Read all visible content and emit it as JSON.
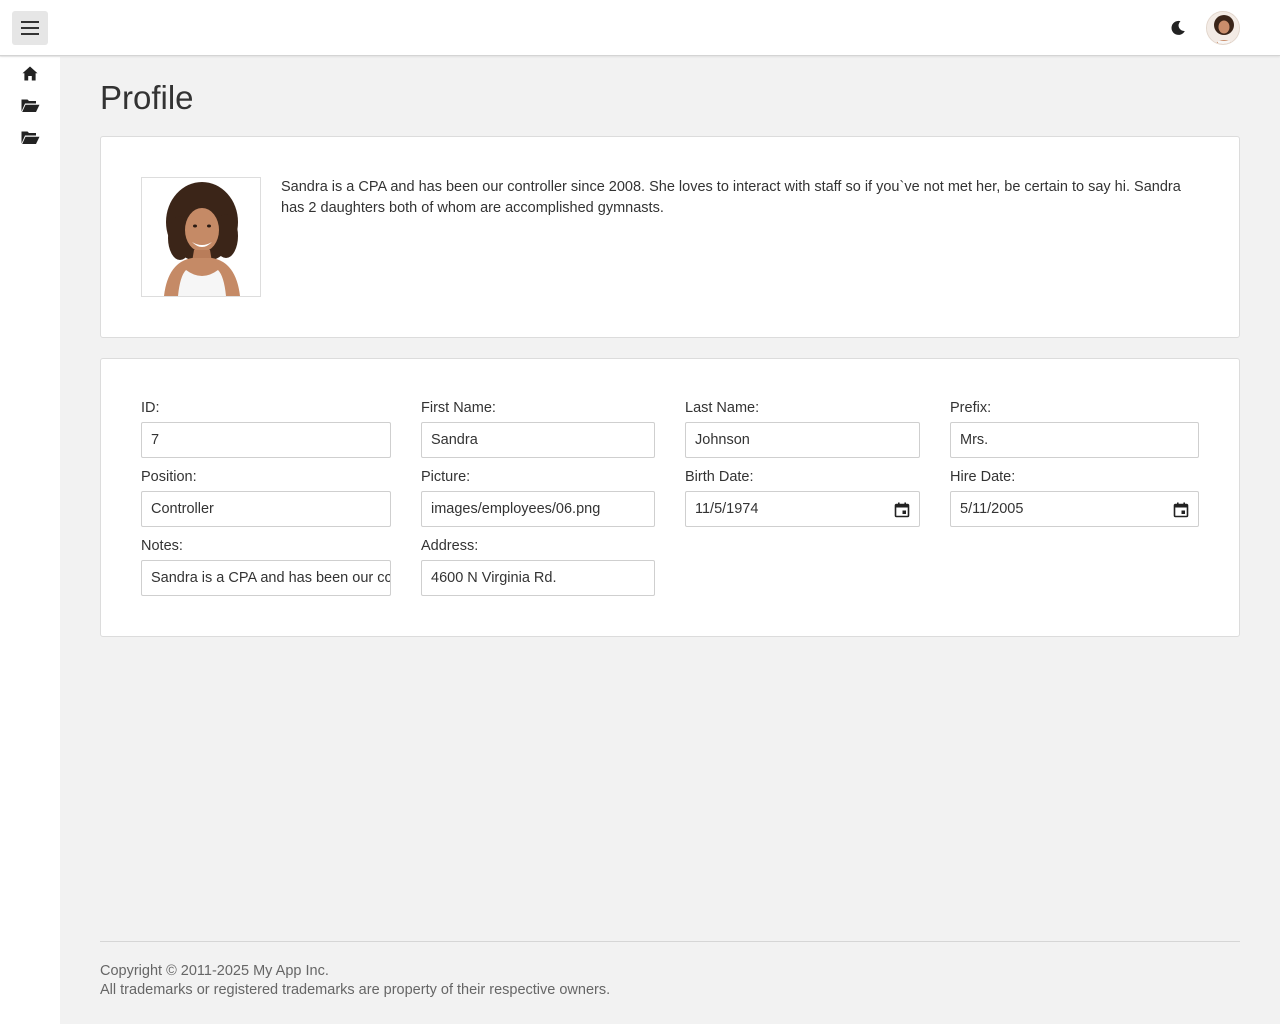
{
  "header": {
    "menu_icon": "hamburger-icon",
    "theme_icon": "moon-icon",
    "avatar_icon": "user-avatar"
  },
  "sidebar": {
    "items": [
      {
        "icon": "home-icon"
      },
      {
        "icon": "folder-open-icon"
      },
      {
        "icon": "folder-open-icon"
      }
    ]
  },
  "page": {
    "title": "Profile"
  },
  "profile": {
    "notes_text": "Sandra is a CPA and has been our controller since 2008. She loves to interact with staff so if you`ve not met her, be certain to say hi. Sandra has 2 daughters both of whom are accomplished gymnasts."
  },
  "form": {
    "id": {
      "label": "ID:",
      "value": "7"
    },
    "first_name": {
      "label": "First Name:",
      "value": "Sandra"
    },
    "last_name": {
      "label": "Last Name:",
      "value": "Johnson"
    },
    "prefix": {
      "label": "Prefix:",
      "value": "Mrs."
    },
    "position": {
      "label": "Position:",
      "value": "Controller"
    },
    "picture": {
      "label": "Picture:",
      "value": "images/employees/06.png"
    },
    "birth_date": {
      "label": "Birth Date:",
      "value": "11/5/1974"
    },
    "hire_date": {
      "label": "Hire Date:",
      "value": "5/11/2005"
    },
    "notes": {
      "label": "Notes:",
      "value": "Sandra is a CPA and has been our cc"
    },
    "address": {
      "label": "Address:",
      "value": "4600 N Virginia Rd."
    }
  },
  "footer": {
    "copyright": "Copyright © 2011-2025 My App Inc.",
    "trademarks": "All trademarks or registered trademarks are property of their respective owners."
  }
}
